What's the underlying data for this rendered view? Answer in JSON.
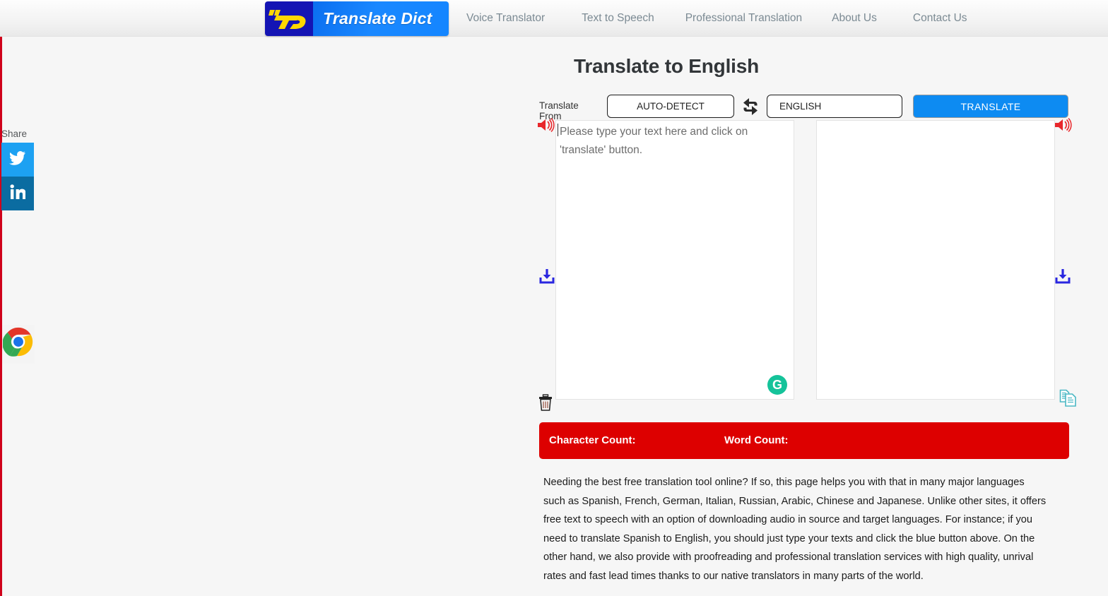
{
  "brand": {
    "mark_text": "TD",
    "name": "Translate Dict"
  },
  "nav": {
    "items": [
      {
        "label": "Voice Translator"
      },
      {
        "label": "Text to Speech"
      },
      {
        "label": "Professional Translation"
      },
      {
        "label": "About Us"
      },
      {
        "label": "Contact Us"
      }
    ]
  },
  "share": {
    "label": "Share",
    "buttons": [
      {
        "name": "twitter",
        "color": "#1da1f2"
      },
      {
        "name": "linkedin",
        "color": "#0b6ca1"
      }
    ]
  },
  "browser": {
    "chrome_icon": "chrome-icon"
  },
  "main": {
    "title": "Translate to English",
    "controls": {
      "from_label": "Translate From",
      "from_value": "AUTO-DETECT",
      "to_value": "ENGLISH",
      "swap_icon": "swap-arrows-icon",
      "translate_button": "TRANSLATE",
      "translate_button_color": "#0d8bf2"
    },
    "source_panel": {
      "placeholder": "Please type your text here and click on 'translate' button.",
      "value": "",
      "speaker_icon": "speaker-icon",
      "download_icon": "download-icon",
      "clear_icon": "trash-icon",
      "grammarly_badge": "G"
    },
    "target_panel": {
      "value": "",
      "speaker_icon": "speaker-icon",
      "download_icon": "download-icon",
      "copy_icon": "copy-icon"
    },
    "counts": {
      "character_label": "Character Count:",
      "character_value": "",
      "word_label": "Word Count:",
      "word_value": "",
      "bar_color": "#dd0000"
    },
    "description": "Needing the best free translation tool online? If so, this page helps you with that in many major languages such as Spanish, French, German, Italian, Russian, Arabic, Chinese and Japanese. Unlike other sites, it offers free text to speech with an option of downloading audio in source and target languages. For instance; if you need to translate Spanish to English, you should just type your texts and click the blue button above. On the other hand, we also provide with proofreading and professional translation services with high quality, unrival rates and fast lead times thanks to our native translators in many parts of the world."
  }
}
